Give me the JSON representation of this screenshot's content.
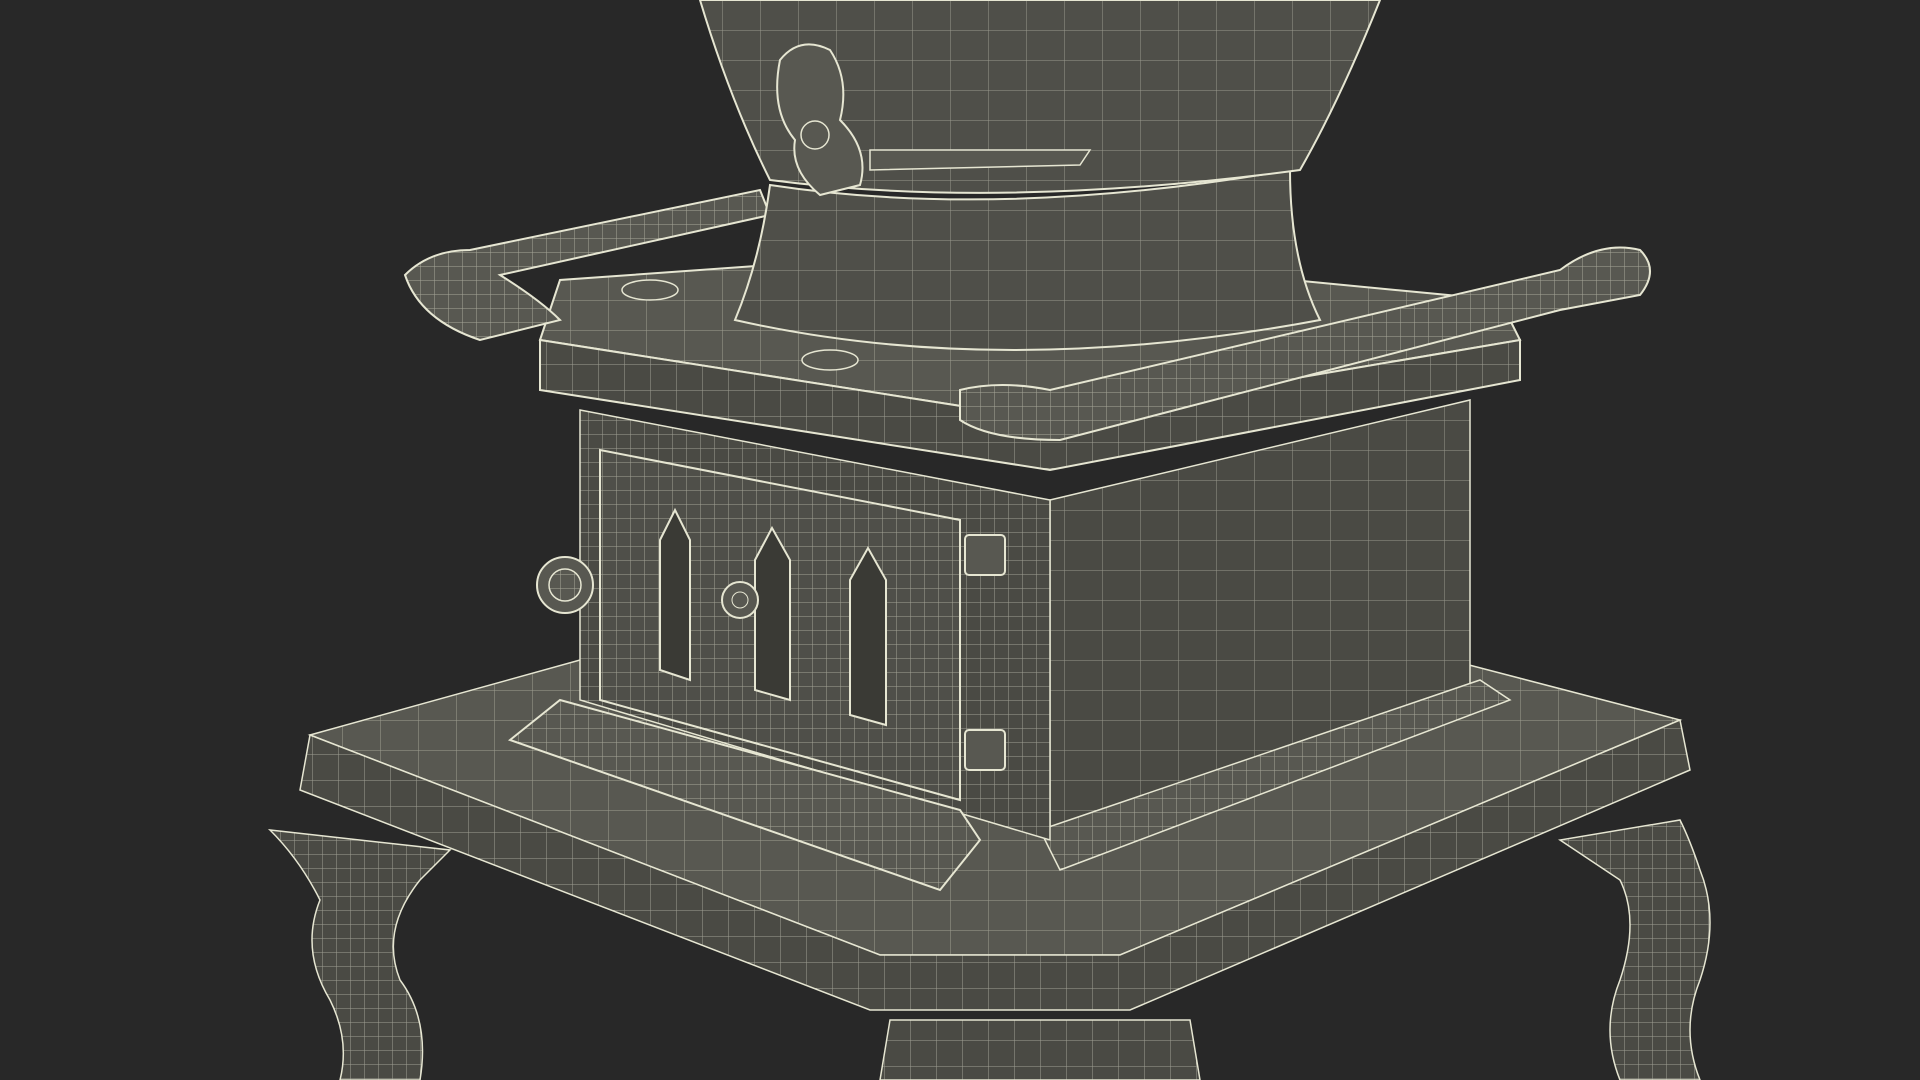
{
  "scene": {
    "background_color": "#282828",
    "solid_color": "#4a4a44",
    "solid_light_color": "#585851",
    "solid_dark_color": "#3a3a35",
    "wire_color": "#e6e6d2",
    "render_style": "wireframe-over-solid",
    "subject": "cast-iron-stove"
  }
}
